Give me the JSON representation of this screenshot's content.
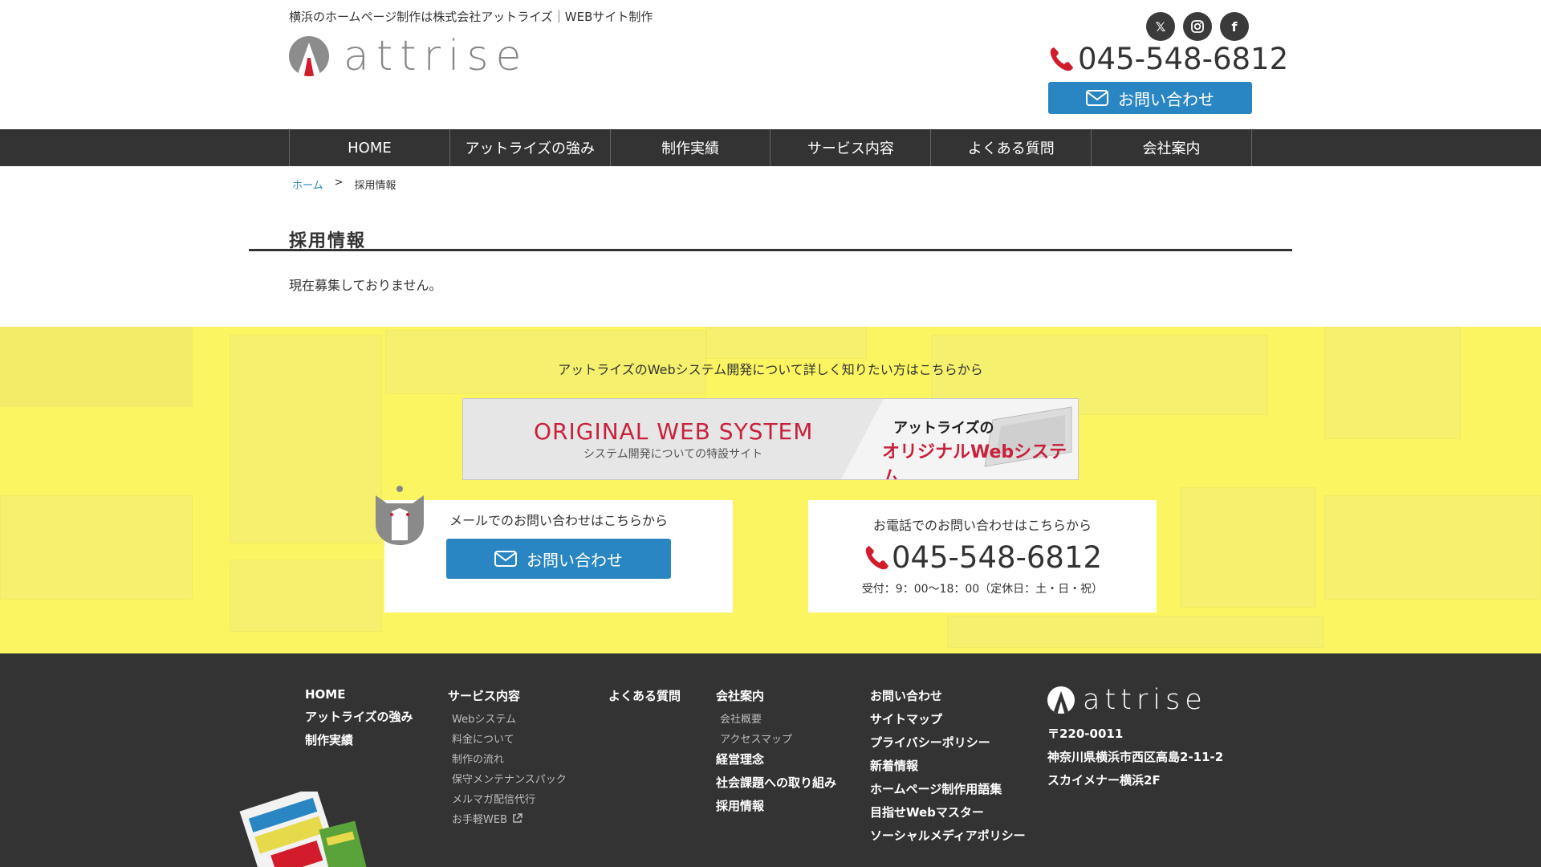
{
  "header": {
    "tagline": "横浜のホームページ制作は株式会社アットライズ｜WEBサイト制作",
    "logo_text": "attrise",
    "social": [
      {
        "icon": "x-icon",
        "glyph": "𝕏"
      },
      {
        "icon": "instagram-icon",
        "glyph": "◎"
      },
      {
        "icon": "facebook-icon",
        "glyph": "f"
      }
    ],
    "phone": "045-548-6812",
    "contact_label": "お問い合わせ"
  },
  "nav": {
    "items": [
      "HOME",
      "アットライズの強み",
      "制作実績",
      "サービス内容",
      "よくある質問",
      "会社案内"
    ]
  },
  "breadcrumb": {
    "home": "ホーム",
    "separator": ">",
    "current": "採用情報"
  },
  "main": {
    "title": "採用情報",
    "body": "現在募集しておりません。"
  },
  "banner_section": {
    "lead": "アットライズのWebシステム開発について詳しく知りたい方はこちらから",
    "web_system_banner": {
      "title": "ORIGINAL WEB SYSTEM",
      "subtitle": "システム開発についての特設サイト",
      "jp_line1": "アットライズの",
      "jp_line2": "オリジナルWebシステム"
    },
    "mail_card": {
      "label": "メールでのお問い合わせはこちらから",
      "button": "お問い合わせ"
    },
    "tel_card": {
      "label": "お電話でのお問い合わせはこちらから",
      "phone": "045-548-6812",
      "hours": "受付：9：00〜18：00（定休日：土・日・祝）"
    }
  },
  "footer": {
    "col1": [
      "HOME",
      "アットライズの強み",
      "制作実績"
    ],
    "col2": {
      "heading": "サービス内容",
      "subs": [
        "Webシステム",
        "料金について",
        "制作の流れ",
        "保守メンテナンスパック",
        "メルマガ配信代行",
        "お手軽WEB"
      ]
    },
    "col3": [
      "よくある質問"
    ],
    "col4": {
      "heading": "会社案内",
      "subs": [
        "会社概要",
        "アクセスマップ"
      ],
      "more": [
        "経営理念",
        "社会課題への取り組み",
        "採用情報"
      ]
    },
    "col5": [
      "お問い合わせ",
      "サイトマップ",
      "プライバシーポリシー",
      "新着情報",
      "ホームページ制作用語集",
      "目指せWebマスター",
      "ソーシャルメディアポリシー"
    ],
    "logo_text": "attrise",
    "address": [
      "〒220-0011",
      "神奈川県横浜市西区高島2-11-2",
      "スカイメナー横浜2F"
    ]
  },
  "colors": {
    "accent_blue": "#2a86c2",
    "brand_red": "#d21c2c",
    "nav_bg": "#333333",
    "banner_yellow": "#f7f06a"
  }
}
